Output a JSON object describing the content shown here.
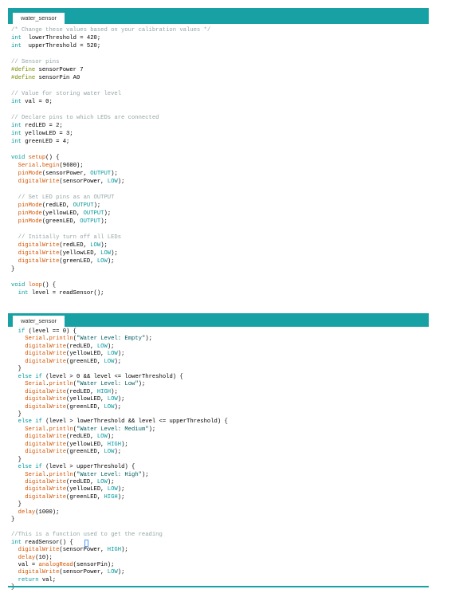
{
  "panes": [
    {
      "tab_label": "water_sensor",
      "lines": [
        [
          [
            "cm",
            "/* Change these values based on your calibration values */"
          ]
        ],
        [
          [
            "kw",
            "int"
          ],
          [
            "",
            "  lowerThreshold = 420;"
          ]
        ],
        [
          [
            "kw",
            "int"
          ],
          [
            "",
            "  upperThreshold = 520;"
          ]
        ],
        [],
        [
          [
            "cm",
            "// Sensor pins"
          ]
        ],
        [
          [
            "pp",
            "#define"
          ],
          [
            "",
            " sensorPower 7"
          ]
        ],
        [
          [
            "pp",
            "#define"
          ],
          [
            "",
            " sensorPin A0"
          ]
        ],
        [],
        [
          [
            "cm",
            "// Value for storing water level"
          ]
        ],
        [
          [
            "kw",
            "int"
          ],
          [
            "",
            " val = 0;"
          ]
        ],
        [],
        [
          [
            "cm",
            "// Declare pins to which LEDs are connected"
          ]
        ],
        [
          [
            "kw",
            "int"
          ],
          [
            "",
            " redLED = 2;"
          ]
        ],
        [
          [
            "kw",
            "int"
          ],
          [
            "",
            " yellowLED = 3;"
          ]
        ],
        [
          [
            "kw",
            "int"
          ],
          [
            "",
            " greenLED = 4;"
          ]
        ],
        [],
        [
          [
            "kw",
            "void"
          ],
          [
            "",
            " "
          ],
          [
            "fn",
            "setup"
          ],
          [
            "",
            "() {"
          ]
        ],
        [
          [
            "",
            "  "
          ],
          [
            "fn",
            "Serial"
          ],
          [
            "",
            "."
          ],
          [
            "fn",
            "begin"
          ],
          [
            "",
            "(9600);"
          ]
        ],
        [
          [
            "",
            "  "
          ],
          [
            "fn",
            "pinMode"
          ],
          [
            "",
            "(sensorPower, "
          ],
          [
            "cn",
            "OUTPUT"
          ],
          [
            "",
            ");"
          ]
        ],
        [
          [
            "",
            "  "
          ],
          [
            "fn",
            "digitalWrite"
          ],
          [
            "",
            "(sensorPower, "
          ],
          [
            "cn",
            "LOW"
          ],
          [
            "",
            ");"
          ]
        ],
        [],
        [
          [
            "",
            "  "
          ],
          [
            "cm",
            "// Set LED pins as an OUTPUT"
          ]
        ],
        [
          [
            "",
            "  "
          ],
          [
            "fn",
            "pinMode"
          ],
          [
            "",
            "(redLED, "
          ],
          [
            "cn",
            "OUTPUT"
          ],
          [
            "",
            ");"
          ]
        ],
        [
          [
            "",
            "  "
          ],
          [
            "fn",
            "pinMode"
          ],
          [
            "",
            "(yellowLED, "
          ],
          [
            "cn",
            "OUTPUT"
          ],
          [
            "",
            ");"
          ]
        ],
        [
          [
            "",
            "  "
          ],
          [
            "fn",
            "pinMode"
          ],
          [
            "",
            "(greenLED, "
          ],
          [
            "cn",
            "OUTPUT"
          ],
          [
            "",
            ");"
          ]
        ],
        [],
        [
          [
            "",
            "  "
          ],
          [
            "cm",
            "// Initially turn off all LEDs"
          ]
        ],
        [
          [
            "",
            "  "
          ],
          [
            "fn",
            "digitalWrite"
          ],
          [
            "",
            "(redLED, "
          ],
          [
            "cn",
            "LOW"
          ],
          [
            "",
            ");"
          ]
        ],
        [
          [
            "",
            "  "
          ],
          [
            "fn",
            "digitalWrite"
          ],
          [
            "",
            "(yellowLED, "
          ],
          [
            "cn",
            "LOW"
          ],
          [
            "",
            ");"
          ]
        ],
        [
          [
            "",
            "  "
          ],
          [
            "fn",
            "digitalWrite"
          ],
          [
            "",
            "(greenLED, "
          ],
          [
            "cn",
            "LOW"
          ],
          [
            "",
            ");"
          ]
        ],
        [
          [
            "",
            "}"
          ]
        ],
        [],
        [
          [
            "kw",
            "void"
          ],
          [
            "",
            " "
          ],
          [
            "fn",
            "loop"
          ],
          [
            "",
            "() {"
          ]
        ],
        [
          [
            "",
            "  "
          ],
          [
            "kw",
            "int"
          ],
          [
            "",
            " level = readSensor();"
          ]
        ]
      ]
    },
    {
      "tab_label": "water_sensor",
      "lines": [
        [
          [
            "",
            "  "
          ],
          [
            "kw",
            "if"
          ],
          [
            "",
            " (level == 0) {"
          ]
        ],
        [
          [
            "",
            "    "
          ],
          [
            "fn",
            "Serial"
          ],
          [
            "",
            "."
          ],
          [
            "fn",
            "println"
          ],
          [
            "",
            "("
          ],
          [
            "st",
            "\"Water Level: Empty\""
          ],
          [
            "",
            ");"
          ]
        ],
        [
          [
            "",
            "    "
          ],
          [
            "fn",
            "digitalWrite"
          ],
          [
            "",
            "(redLED, "
          ],
          [
            "cn",
            "LOW"
          ],
          [
            "",
            ");"
          ]
        ],
        [
          [
            "",
            "    "
          ],
          [
            "fn",
            "digitalWrite"
          ],
          [
            "",
            "(yellowLED, "
          ],
          [
            "cn",
            "LOW"
          ],
          [
            "",
            ");"
          ]
        ],
        [
          [
            "",
            "    "
          ],
          [
            "fn",
            "digitalWrite"
          ],
          [
            "",
            "(greenLED, "
          ],
          [
            "cn",
            "LOW"
          ],
          [
            "",
            ");"
          ]
        ],
        [
          [
            "",
            "  }"
          ]
        ],
        [
          [
            "",
            "  "
          ],
          [
            "kw",
            "else"
          ],
          [
            "",
            " "
          ],
          [
            "kw",
            "if"
          ],
          [
            "",
            " (level > 0 && level <= lowerThreshold) {"
          ]
        ],
        [
          [
            "",
            "    "
          ],
          [
            "fn",
            "Serial"
          ],
          [
            "",
            "."
          ],
          [
            "fn",
            "println"
          ],
          [
            "",
            "("
          ],
          [
            "st",
            "\"Water Level: Low\""
          ],
          [
            "",
            ");"
          ]
        ],
        [
          [
            "",
            "    "
          ],
          [
            "fn",
            "digitalWrite"
          ],
          [
            "",
            "(redLED, "
          ],
          [
            "cn",
            "HIGH"
          ],
          [
            "",
            ");"
          ]
        ],
        [
          [
            "",
            "    "
          ],
          [
            "fn",
            "digitalWrite"
          ],
          [
            "",
            "(yellowLED, "
          ],
          [
            "cn",
            "LOW"
          ],
          [
            "",
            ");"
          ]
        ],
        [
          [
            "",
            "    "
          ],
          [
            "fn",
            "digitalWrite"
          ],
          [
            "",
            "(greenLED, "
          ],
          [
            "cn",
            "LOW"
          ],
          [
            "",
            ");"
          ]
        ],
        [
          [
            "",
            "  }"
          ]
        ],
        [
          [
            "",
            "  "
          ],
          [
            "kw",
            "else"
          ],
          [
            "",
            " "
          ],
          [
            "kw",
            "if"
          ],
          [
            "",
            " (level > lowerThreshold && level <= upperThreshold) {"
          ]
        ],
        [
          [
            "",
            "    "
          ],
          [
            "fn",
            "Serial"
          ],
          [
            "",
            "."
          ],
          [
            "fn",
            "println"
          ],
          [
            "",
            "("
          ],
          [
            "st",
            "\"Water Level: Medium\""
          ],
          [
            "",
            ");"
          ]
        ],
        [
          [
            "",
            "    "
          ],
          [
            "fn",
            "digitalWrite"
          ],
          [
            "",
            "(redLED, "
          ],
          [
            "cn",
            "LOW"
          ],
          [
            "",
            ");"
          ]
        ],
        [
          [
            "",
            "    "
          ],
          [
            "fn",
            "digitalWrite"
          ],
          [
            "",
            "(yellowLED, "
          ],
          [
            "cn",
            "HIGH"
          ],
          [
            "",
            ");"
          ]
        ],
        [
          [
            "",
            "    "
          ],
          [
            "fn",
            "digitalWrite"
          ],
          [
            "",
            "(greenLED, "
          ],
          [
            "cn",
            "LOW"
          ],
          [
            "",
            ");"
          ]
        ],
        [
          [
            "",
            "  }"
          ]
        ],
        [
          [
            "",
            "  "
          ],
          [
            "kw",
            "else"
          ],
          [
            "",
            " "
          ],
          [
            "kw",
            "if"
          ],
          [
            "",
            " (level > upperThreshold) {"
          ]
        ],
        [
          [
            "",
            "    "
          ],
          [
            "fn",
            "Serial"
          ],
          [
            "",
            "."
          ],
          [
            "fn",
            "println"
          ],
          [
            "",
            "("
          ],
          [
            "st",
            "\"Water Level: High\""
          ],
          [
            "",
            ");"
          ]
        ],
        [
          [
            "",
            "    "
          ],
          [
            "fn",
            "digitalWrite"
          ],
          [
            "",
            "(redLED, "
          ],
          [
            "cn",
            "LOW"
          ],
          [
            "",
            ");"
          ]
        ],
        [
          [
            "",
            "    "
          ],
          [
            "fn",
            "digitalWrite"
          ],
          [
            "",
            "(yellowLED, "
          ],
          [
            "cn",
            "LOW"
          ],
          [
            "",
            ");"
          ]
        ],
        [
          [
            "",
            "    "
          ],
          [
            "fn",
            "digitalWrite"
          ],
          [
            "",
            "(greenLED, "
          ],
          [
            "cn",
            "HIGH"
          ],
          [
            "",
            ");"
          ]
        ],
        [
          [
            "",
            "  }"
          ]
        ],
        [
          [
            "",
            "  "
          ],
          [
            "fn",
            "delay"
          ],
          [
            "",
            "(1000);"
          ]
        ],
        [
          [
            "",
            "}"
          ]
        ],
        [],
        [
          [
            "cm",
            "//This is a function used to get the reading"
          ]
        ],
        [
          [
            "kw",
            "int"
          ],
          [
            "",
            " readSensor() {"
          ]
        ],
        [
          [
            "",
            "  "
          ],
          [
            "fn",
            "digitalWrite"
          ],
          [
            "",
            "(sensorPower, "
          ],
          [
            "cn",
            "HIGH"
          ],
          [
            "",
            ");"
          ]
        ],
        [
          [
            "",
            "  "
          ],
          [
            "fn",
            "delay"
          ],
          [
            "",
            "(10);"
          ]
        ],
        [
          [
            "",
            "  val = "
          ],
          [
            "fn",
            "analogRead"
          ],
          [
            "",
            "(sensorPin);"
          ]
        ],
        [
          [
            "",
            "  "
          ],
          [
            "fn",
            "digitalWrite"
          ],
          [
            "",
            "(sensorPower, "
          ],
          [
            "cn",
            "LOW"
          ],
          [
            "",
            ");"
          ]
        ],
        [
          [
            "",
            "  "
          ],
          [
            "kw",
            "return"
          ],
          [
            "",
            " val;"
          ]
        ],
        [
          [
            "",
            "}"
          ]
        ]
      ]
    }
  ],
  "colors": {
    "tab_bar": "#17a1a5",
    "comment": "#95a5a6",
    "keyword": "#00979c",
    "function": "#d35400",
    "constant": "#00979c",
    "preprocessor": "#728e00",
    "string": "#005c5f"
  }
}
